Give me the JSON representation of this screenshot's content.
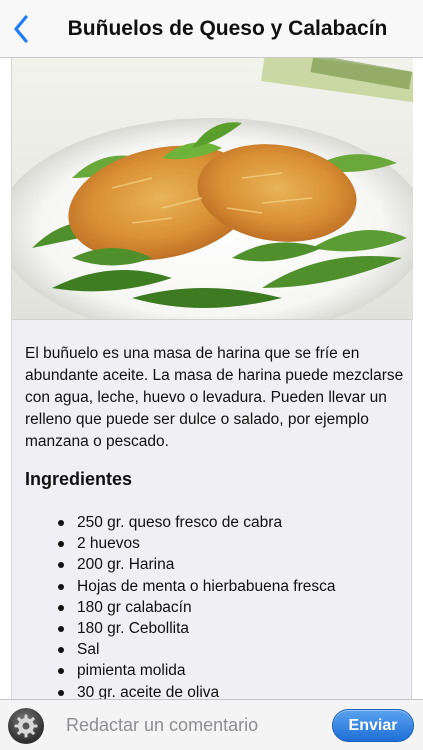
{
  "nav": {
    "title": "Buñuelos de Queso y Calabacín",
    "back_icon": "chevron-left-icon",
    "accent_color": "#1f7cf4"
  },
  "article": {
    "description": "El buñuelo es una masa de harina que se fríe en abundante aceite. La masa de harina puede mezclarse con agua, leche, huevo o levadura. Pueden llevar un relleno que puede ser dulce o salado, por ejemplo manzana o pescado.",
    "ingredients_title": "Ingredientes",
    "ingredients": [
      "250 gr. queso fresco de cabra",
      "2 huevos",
      "200 gr. Harina",
      "Hojas de menta o hierbabuena fresca",
      "180 gr calabacín",
      "180 gr. Cebollita",
      "Sal",
      "pimienta molida",
      "30 gr. aceite de oliva"
    ]
  },
  "bottombar": {
    "settings_icon": "gear-icon",
    "comment_placeholder": "Redactar un comentario",
    "comment_value": "",
    "send_label": "Enviar",
    "send_color": "#2a7be0"
  }
}
